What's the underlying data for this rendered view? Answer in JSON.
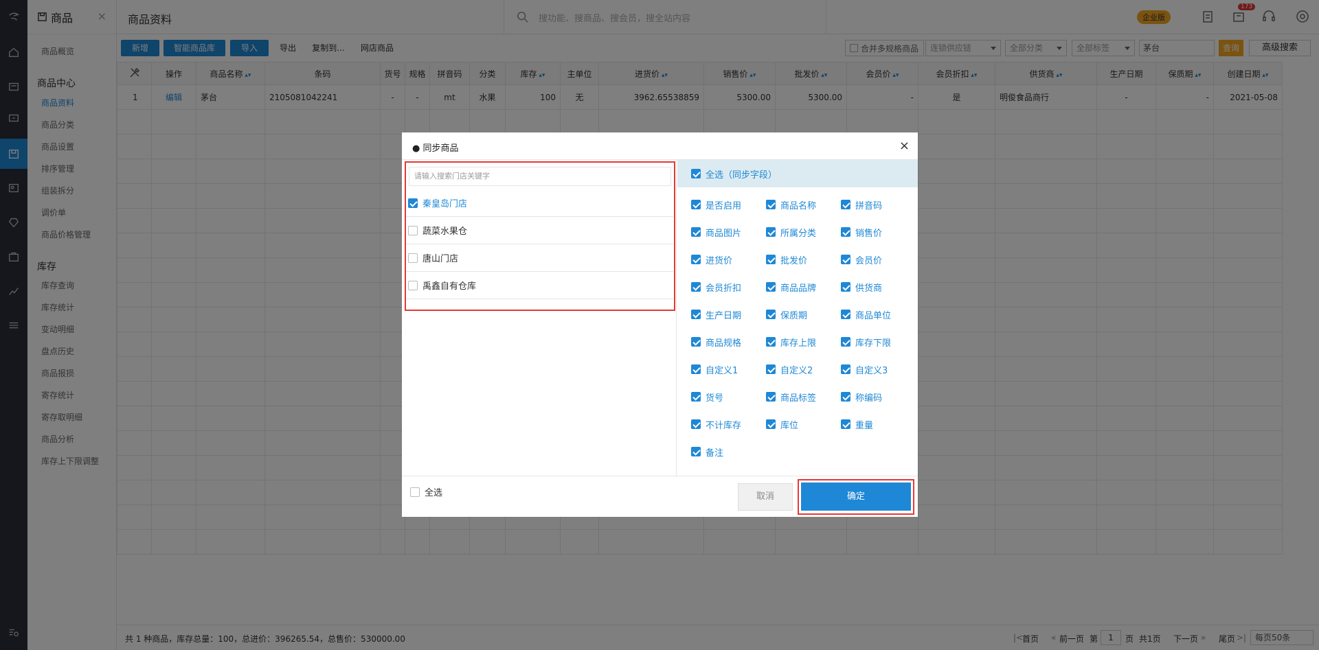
{
  "module": {
    "title": "商品",
    "close": "×"
  },
  "sidebar": {
    "overview": "商品概览",
    "group1": "商品中心",
    "items1": [
      "商品资料",
      "商品分类",
      "商品设置",
      "排序管理",
      "组装拆分",
      "调价单",
      "商品价格管理"
    ],
    "group2": "库存",
    "items2": [
      "库存查询",
      "库存统计",
      "变动明细",
      "盘点历史",
      "商品报损",
      "寄存统计",
      "寄存取明细",
      "商品分析",
      "库存上下限调整"
    ]
  },
  "topbar": {
    "title": "商品资料",
    "search_placeholder": "搜功能、搜商品、搜会员，搜全站内容",
    "edition": "企业版",
    "notify_count": "173"
  },
  "toolbar": {
    "buttons": [
      "新增",
      "智能商品库",
      "导入",
      "导出",
      "复制到...",
      "网店商品"
    ],
    "merge_spec": "合并多规格商品",
    "filters": [
      "连锁供应链",
      "全部分类",
      "全部标签"
    ],
    "keyword": "茅台",
    "query": "查询",
    "advanced": "高级搜索"
  },
  "table": {
    "headers": [
      "",
      "操作",
      "商品名称",
      "条码",
      "货号",
      "规格",
      "拼音码",
      "分类",
      "库存",
      "主单位",
      "进货价",
      "销售价",
      "批发价",
      "会员价",
      "会员折扣",
      "供货商",
      "生产日期",
      "保质期",
      "创建日期"
    ],
    "rows": [
      [
        "1",
        "编辑",
        "茅台",
        "2105081042241",
        "-",
        "-",
        "mt",
        "水果",
        "100",
        "无",
        "3962.65538859",
        "5300.00",
        "5300.00",
        "-",
        "是",
        "明俊食品商行",
        "-",
        "-",
        "2021-05-08"
      ]
    ]
  },
  "footer": {
    "summary": "共 1 种商品，库存总量：100，总进价：396265.54，总售价：530000.00",
    "first": "首页",
    "prev": "前一页",
    "page_prefix": "第",
    "page": "1",
    "page_suffix": "页",
    "total": "共1页",
    "next": "下一页",
    "last": "尾页",
    "per_page": "每页50条"
  },
  "modal": {
    "title": "● 同步商品",
    "close": "×",
    "search_placeholder": "请输入搜索门店关键字",
    "stores": [
      {
        "name": "秦皇岛门店",
        "checked": true
      },
      {
        "name": "蔬菜水果仓",
        "checked": false
      },
      {
        "name": "唐山门店",
        "checked": false
      },
      {
        "name": "禹鑫自有仓库",
        "checked": false
      }
    ],
    "select_all_fields": "全选（同步字段）",
    "fields": [
      "是否启用",
      "商品名称",
      "拼音码",
      "商品图片",
      "所属分类",
      "销售价",
      "进货价",
      "批发价",
      "会员价",
      "会员折扣",
      "商品品牌",
      "供货商",
      "生产日期",
      "保质期",
      "商品单位",
      "商品规格",
      "库存上限",
      "库存下限",
      "自定义1",
      "自定义2",
      "自定义3",
      "货号",
      "商品标签",
      "称编码",
      "不计库存",
      "库位",
      "重量",
      "备注"
    ],
    "select_all": "全选",
    "cancel": "取消",
    "confirm": "确定"
  }
}
